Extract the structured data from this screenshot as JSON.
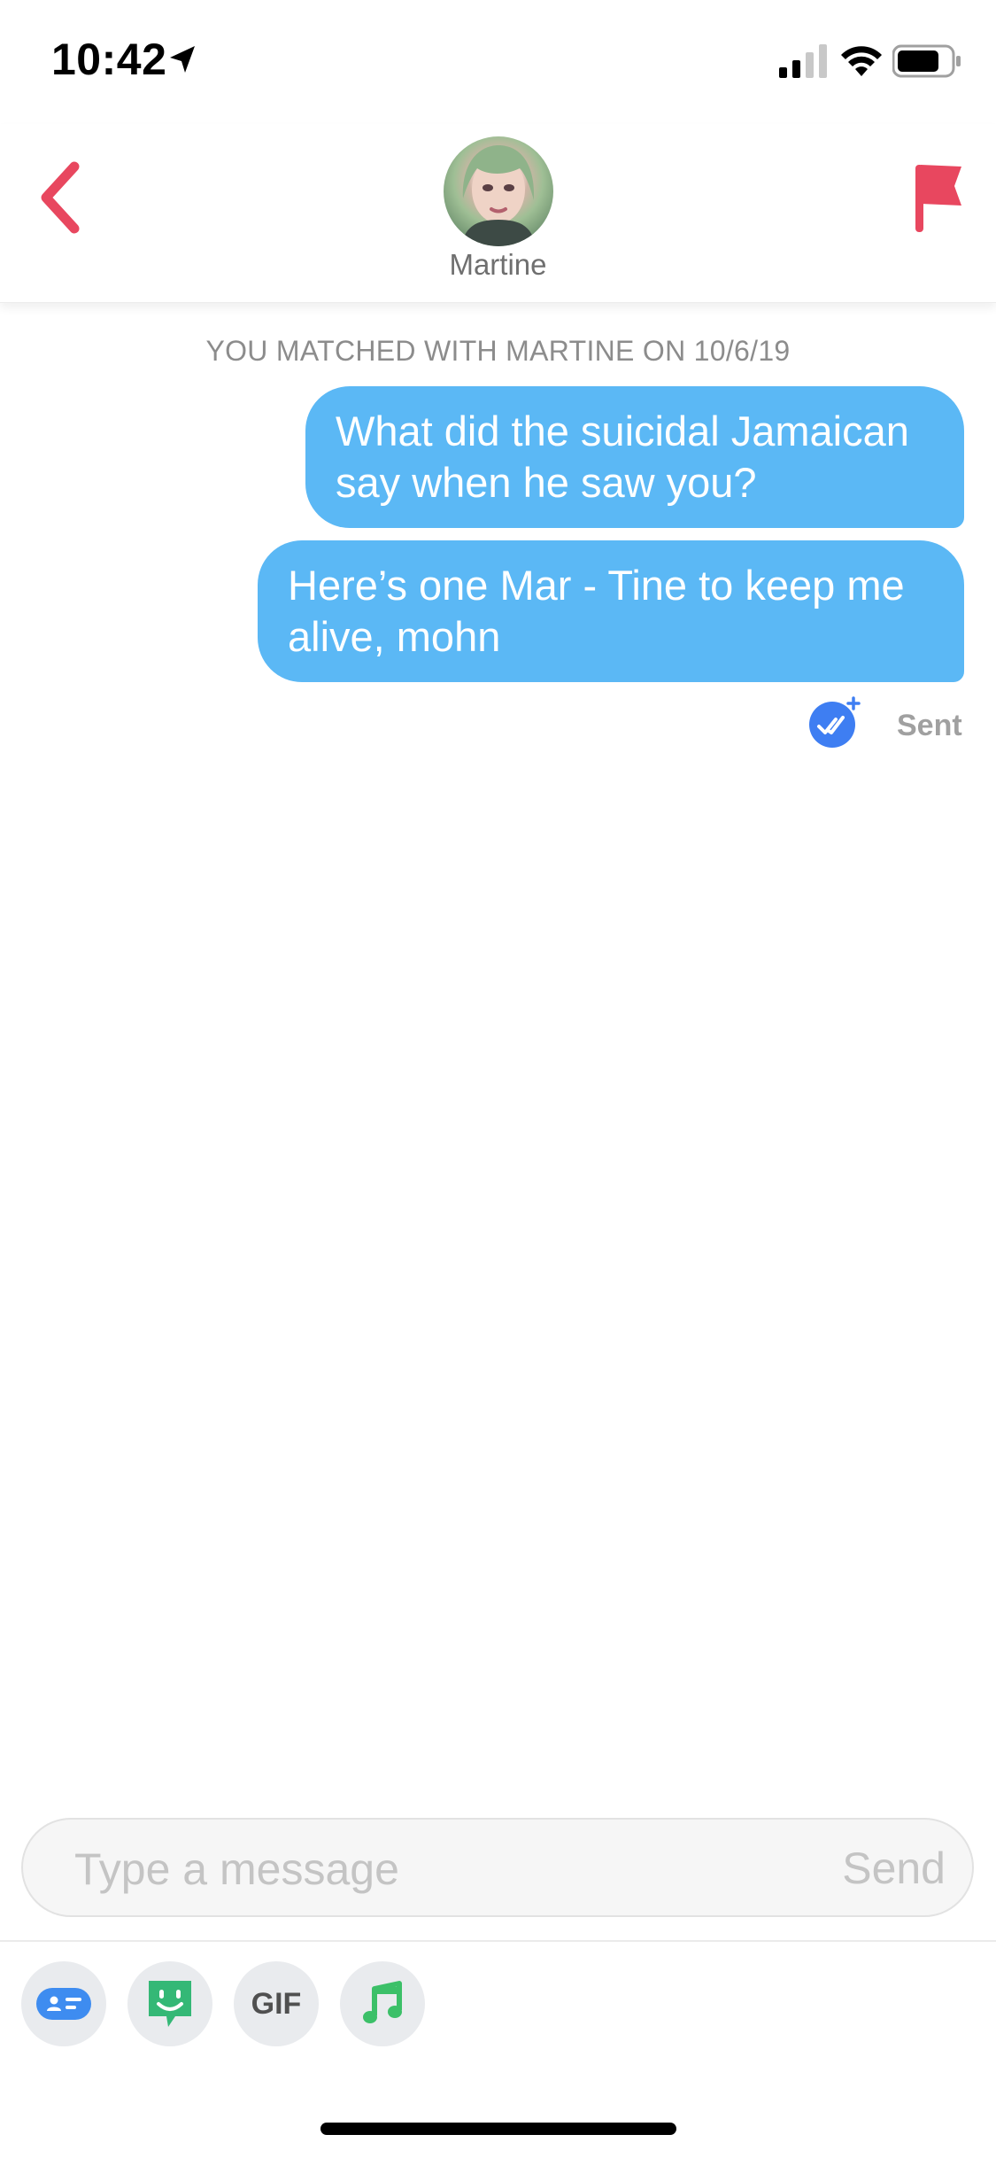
{
  "status_bar": {
    "time": "10:42",
    "icons": [
      "location-arrow-icon",
      "cell-signal-icon",
      "wifi-icon",
      "battery-icon"
    ]
  },
  "header": {
    "contact_name": "Martine",
    "icons": {
      "back": "chevron-left-icon",
      "report": "flag-icon"
    },
    "accent_color": "#e8475f"
  },
  "chat": {
    "match_info": "YOU MATCHED WITH MARTINE ON 10/6/19",
    "messages": [
      {
        "sender": "me",
        "text": "What did the suicidal Jamaican say when he saw you?"
      },
      {
        "sender": "me",
        "text": "Here’s one Mar - Tine to keep me alive, mohn"
      }
    ],
    "status_label": "Sent",
    "bubble_color": "#5bb8f5",
    "receipt_color": "#3e7ef2"
  },
  "composer": {
    "placeholder": "Type a message",
    "value": "",
    "send_label": "Send"
  },
  "toolbar": {
    "buttons": [
      {
        "icon": "message-card-icon"
      },
      {
        "icon": "sticker-icon"
      },
      {
        "icon": "gif-icon",
        "label": "GIF"
      },
      {
        "icon": "music-note-icon"
      }
    ]
  }
}
